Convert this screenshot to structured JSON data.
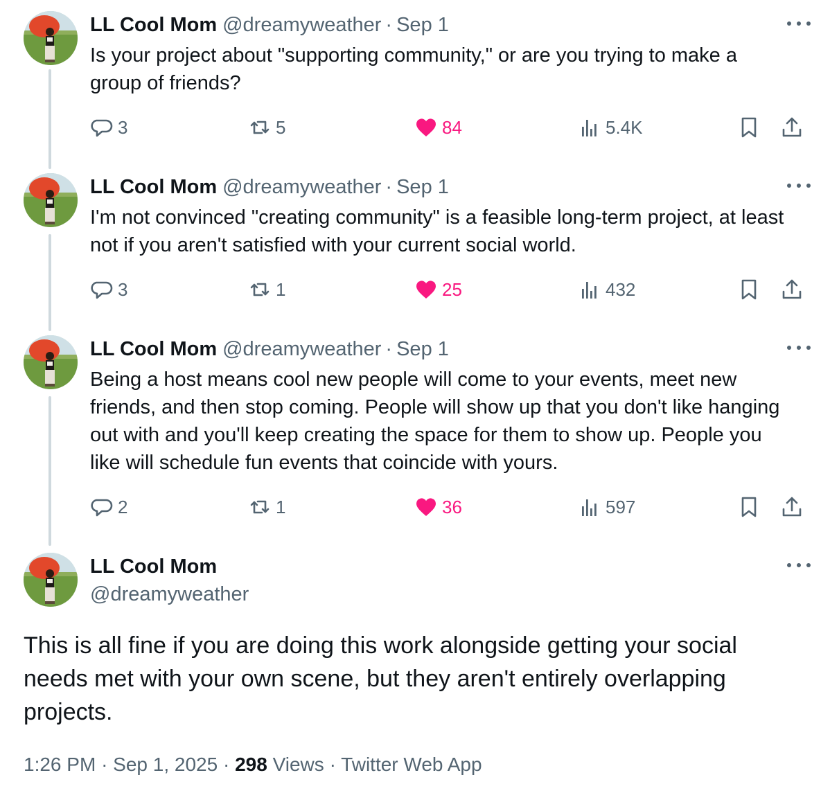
{
  "thread": [
    {
      "author_name": "LL Cool Mom",
      "handle": "@dreamyweather",
      "separator": "·",
      "date": "Sep 1",
      "text": "Is your project about \"supporting community,\" or are you trying to make a group of friends?",
      "replies": "3",
      "reposts": "5",
      "likes": "84",
      "views": "5.4K"
    },
    {
      "author_name": "LL Cool Mom",
      "handle": "@dreamyweather",
      "separator": "·",
      "date": "Sep 1",
      "text": "I'm not convinced \"creating community\" is a feasible long-term project, at least not if you aren't satisfied with your current social world.",
      "replies": "3",
      "reposts": "1",
      "likes": "25",
      "views": "432"
    },
    {
      "author_name": "LL Cool Mom",
      "handle": "@dreamyweather",
      "separator": "·",
      "date": "Sep 1",
      "text": "Being a host means cool new people will come to your events, meet new friends, and then stop coming. People will show up that you don't like hanging out with and you'll keep creating the space for them to show up. People you like will schedule fun events that coincide with yours.",
      "replies": "2",
      "reposts": "1",
      "likes": "36",
      "views": "597"
    }
  ],
  "main_tweet": {
    "author_name": "LL Cool Mom",
    "handle": "@dreamyweather",
    "text": "This is all fine if you are doing this work alongside getting your social needs met with your own scene, but they aren't entirely overlapping projects.",
    "time": "1:26 PM",
    "sep1": "·",
    "date": "Sep 1, 2025",
    "sep2": "·",
    "views_count": "298",
    "views_label": "Views",
    "sep3": "·",
    "source": "Twitter Web App"
  },
  "colors": {
    "text": "#0f1419",
    "secondary": "#536471",
    "like": "#f91880",
    "thread_line": "#cfd9de"
  },
  "icons": [
    "reply-icon",
    "repost-icon",
    "like-icon",
    "views-icon",
    "bookmark-icon",
    "share-icon",
    "more-icon"
  ]
}
